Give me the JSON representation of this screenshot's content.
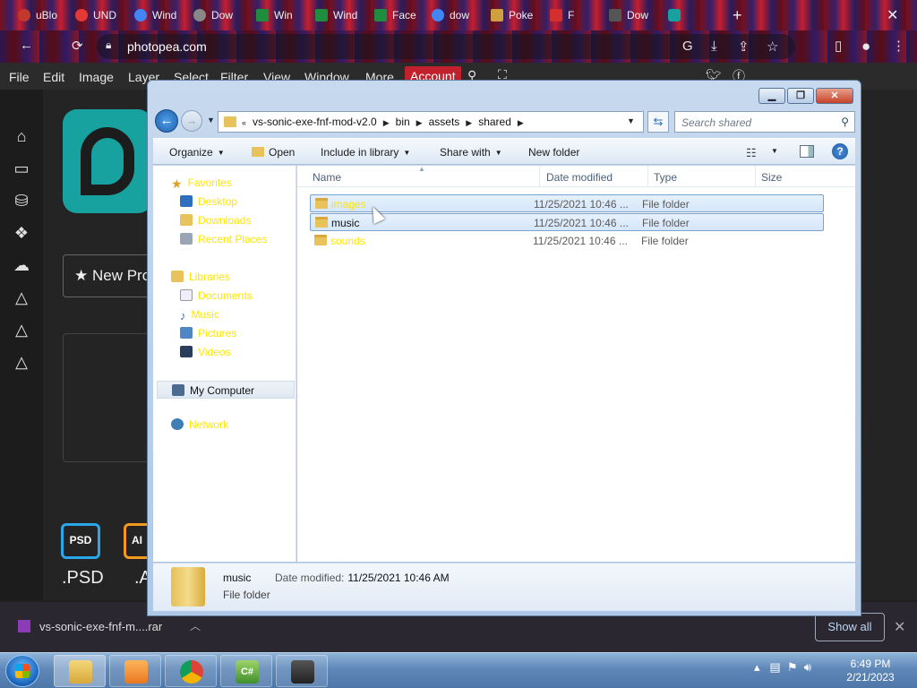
{
  "browser": {
    "tabs": [
      {
        "label": "uBlo",
        "color": "#c0392b"
      },
      {
        "label": "UND",
        "color": "#e53935"
      },
      {
        "label": "Wind",
        "color": "#4285f4"
      },
      {
        "label": "Dow",
        "color": "#888888"
      },
      {
        "label": "Win",
        "color": "#1e8e3e"
      },
      {
        "label": "Wind",
        "color": "#1e8e3e"
      },
      {
        "label": "Face",
        "color": "#1e8e3e"
      },
      {
        "label": "dow",
        "color": "#4285f4"
      },
      {
        "label": "Poke",
        "color": "#d0a040"
      },
      {
        "label": "F",
        "color": "#d32f2f"
      },
      {
        "label": "Dow",
        "color": "#555555"
      },
      {
        "label": "",
        "color": "#17a2a0"
      }
    ],
    "url": "photopea.com"
  },
  "photopea": {
    "menu": [
      "File",
      "Edit",
      "Image",
      "Layer",
      "Select",
      "Filter",
      "View",
      "Window",
      "More"
    ],
    "account": "Account",
    "new_project": "★  New Pro",
    "psd_badge": "PSD",
    "psd_label": ".PSD",
    "ai_badge": "AI",
    "ai_label": ".A"
  },
  "download_bar": {
    "file": "vs-sonic-exe-fnf-m....rar",
    "show_all": "Show all"
  },
  "explorer": {
    "breadcrumb": [
      "vs-sonic-exe-fnf-mod-v2.0",
      "bin",
      "assets",
      "shared"
    ],
    "search_placeholder": "Search shared",
    "commands": {
      "organize": "Organize",
      "open": "Open",
      "include": "Include in library",
      "share": "Share with",
      "new_folder": "New folder"
    },
    "nav": {
      "favorites": "Favorites",
      "desktop": "Desktop",
      "downloads": "Downloads",
      "recent": "Recent Places",
      "libraries": "Libraries",
      "documents": "Documents",
      "music": "Music",
      "pictures": "Pictures",
      "videos": "Videos",
      "my_computer": "My Computer",
      "network": "Network"
    },
    "columns": {
      "name": "Name",
      "date": "Date modified",
      "type": "Type",
      "size": "Size"
    },
    "files": [
      {
        "name": "images",
        "date": "11/25/2021 10:46 ...",
        "type": "File folder"
      },
      {
        "name": "music",
        "date": "11/25/2021 10:46 ...",
        "type": "File folder"
      },
      {
        "name": "sounds",
        "date": "11/25/2021 10:46 ...",
        "type": "File folder"
      }
    ],
    "details": {
      "name": "music",
      "type": "File folder",
      "modified_label": "Date modified:",
      "modified_value": "11/25/2021 10:46 AM"
    }
  },
  "taskbar": {
    "time": "6:49 PM",
    "date": "2/21/2023"
  }
}
